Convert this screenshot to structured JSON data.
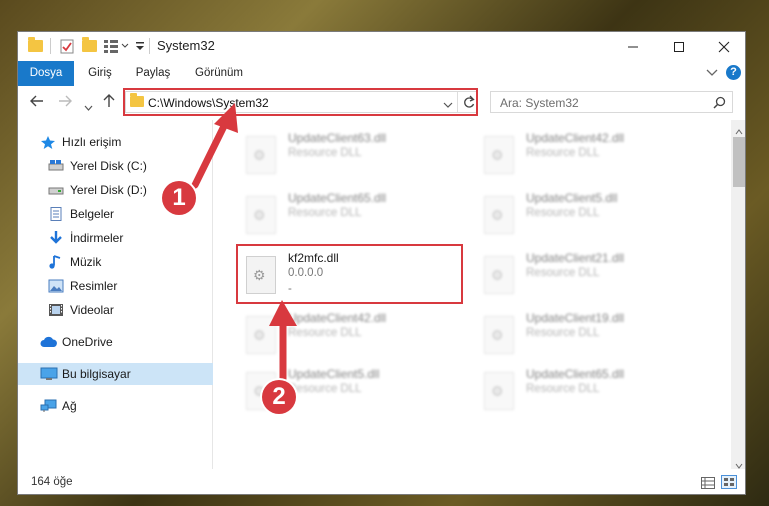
{
  "window": {
    "title": "System32"
  },
  "ribbon": {
    "tabs": [
      {
        "label": "Dosya"
      },
      {
        "label": "Giriş"
      },
      {
        "label": "Paylaş"
      },
      {
        "label": "Görünüm"
      }
    ]
  },
  "address": {
    "path": "C:\\Windows\\System32"
  },
  "search": {
    "placeholder": "Ara: System32"
  },
  "sidebar": {
    "items": [
      {
        "label": "Hızlı erişim",
        "icon": "star-icon"
      },
      {
        "label": "Yerel Disk (C:)",
        "icon": "drive-icon"
      },
      {
        "label": "Yerel Disk (D:)",
        "icon": "drive-icon"
      },
      {
        "label": "Belgeler",
        "icon": "documents-icon"
      },
      {
        "label": "İndirmeler",
        "icon": "download-icon"
      },
      {
        "label": "Müzik",
        "icon": "music-icon"
      },
      {
        "label": "Resimler",
        "icon": "pictures-icon"
      },
      {
        "label": "Videolar",
        "icon": "videos-icon"
      },
      {
        "label": "OneDrive",
        "icon": "cloud-icon"
      },
      {
        "label": "Bu bilgisayar",
        "icon": "computer-icon"
      },
      {
        "label": "Ağ",
        "icon": "network-icon"
      }
    ]
  },
  "files": [
    {
      "name": "UpdateClient63.dll",
      "desc": "Resource DLL"
    },
    {
      "name": "UpdateClient42.dll",
      "desc": "Resource DLL"
    },
    {
      "name": "UpdateClient65.dll",
      "desc": "Resource DLL"
    },
    {
      "name": "UpdateClient5.dll",
      "desc": "Resource DLL"
    },
    {
      "name": "kf2mfc.dll",
      "desc": "0.0.0.0",
      "extra": "-"
    },
    {
      "name": "UpdateClient21.dll",
      "desc": "Resource DLL"
    },
    {
      "name": "UpdateClient42.dll",
      "desc": "Resource DLL"
    },
    {
      "name": "UpdateClient19.dll",
      "desc": "Resource DLL"
    },
    {
      "name": "UpdateClient5.dll",
      "desc": "Resource DLL"
    },
    {
      "name": "UpdateClient65.dll",
      "desc": "Resource DLL"
    }
  ],
  "status": {
    "count": "164 öğe"
  },
  "annotations": {
    "badge1": "1",
    "badge2": "2",
    "color": "#d8393f"
  }
}
